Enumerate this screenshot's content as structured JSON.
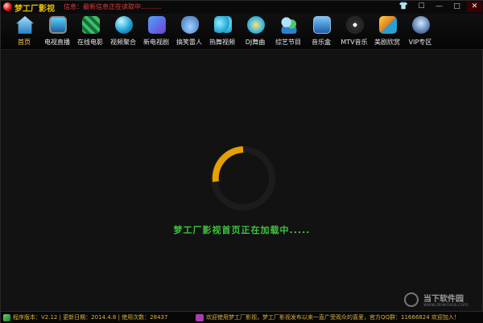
{
  "window": {
    "title": "梦工厂影视",
    "ticker": "信息：最新信息正在读取中..........",
    "controls": [
      "shirt-icon",
      "chat-icon",
      "minimize-icon",
      "maximize-icon",
      "close-icon"
    ]
  },
  "toolbar": {
    "items": [
      {
        "label": "首页",
        "icon": "home-icon",
        "active": true
      },
      {
        "label": "电视直播",
        "icon": "tv-icon"
      },
      {
        "label": "在线电影",
        "icon": "film-icon"
      },
      {
        "label": "视频聚合",
        "icon": "globe-icon"
      },
      {
        "label": "新电视剧",
        "icon": "music-note-icon"
      },
      {
        "label": "搞笑雷人",
        "icon": "footprint-icon"
      },
      {
        "label": "热舞视频",
        "icon": "butterfly-icon"
      },
      {
        "label": "DJ舞曲",
        "icon": "dj-icon"
      },
      {
        "label": "综艺节目",
        "icon": "people-icon"
      },
      {
        "label": "音乐盒",
        "icon": "music-box-icon"
      },
      {
        "label": "MTV音乐",
        "icon": "mtv-icon"
      },
      {
        "label": "美剧欣赏",
        "icon": "drama-icon"
      },
      {
        "label": "VIP专区",
        "icon": "vip-icon"
      }
    ]
  },
  "main": {
    "loading_text": "梦工厂影视首页正在加载中....."
  },
  "statusbar": {
    "version": "程序版本：V2.12",
    "update_date": "更新日期：2014.4.8",
    "usage_count": "使用次数：28437",
    "welcome": "欢迎使用梦工厂影视，梦工厂影视发布以来一直广受观众的喜爱，官方QQ群：11666824 欢迎加入！"
  },
  "watermark": {
    "name": "当下软件园",
    "sub": "www.downxia.com"
  },
  "colors": {
    "title": "#e8c000",
    "ticker": "#e03a3a",
    "loading": "#3ec43e",
    "spinner_arc": "#e6a000",
    "status_text": "#d9b33a"
  }
}
